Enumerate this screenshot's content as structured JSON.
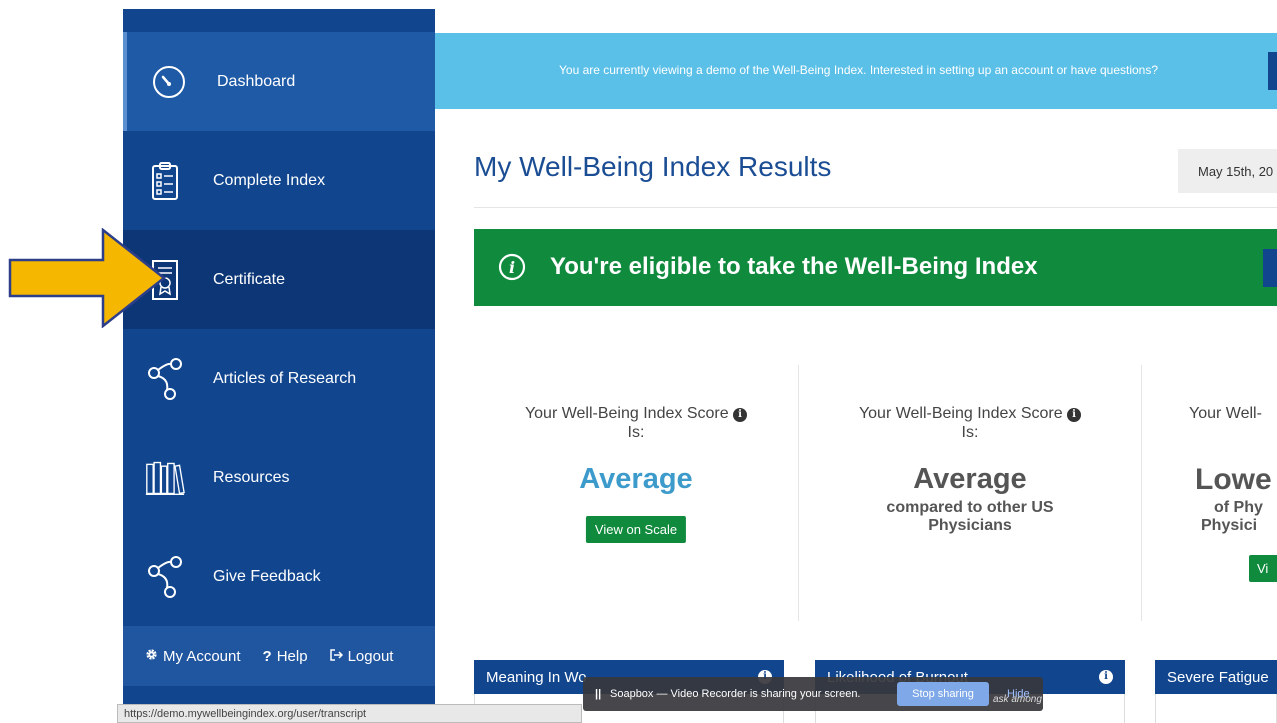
{
  "sidebar": {
    "items": [
      {
        "label": "Dashboard"
      },
      {
        "label": "Complete Index"
      },
      {
        "label": "Certificate"
      },
      {
        "label": "Articles of Research"
      },
      {
        "label": "Resources"
      },
      {
        "label": "Give Feedback"
      }
    ],
    "account": {
      "my_account": "My Account",
      "help": "Help",
      "logout": "Logout"
    }
  },
  "banner": {
    "text": "You are currently viewing a demo of the Well-Being Index. Interested in setting up an account or have questions?"
  },
  "header": {
    "title": "My Well-Being Index Results",
    "date": "May 15th, 20"
  },
  "eligible": {
    "text": "You're eligible to take the Well-Being Index"
  },
  "scores": [
    {
      "label_line1": "Your Well-Being Index Score",
      "label_line2": "Is:",
      "value": "Average",
      "button": "View on Scale"
    },
    {
      "label_line1": "Your Well-Being Index Score",
      "label_line2": "Is:",
      "value": "Average",
      "sub_line1": "compared to other US",
      "sub_line2": "Physicians"
    },
    {
      "label_line1": "Your Well-",
      "value": "Lowe",
      "sub_line1": "of Phy",
      "sub_line2": "Physici",
      "button": "Vi"
    }
  ],
  "cards": [
    {
      "title": "Meaning In Wo"
    },
    {
      "title": "Likelihood of Burnout"
    },
    {
      "title": "Severe Fatigue"
    }
  ],
  "status_url": "https://demo.mywellbeingindex.org/user/transcript",
  "share_bar": {
    "message": "Soapbox — Video Recorder is sharing your screen.",
    "stop": "Stop sharing",
    "hide": "Hide",
    "under_text": "ask among"
  },
  "colors": {
    "sidebar": "#11468f",
    "banner": "#5bc0e8",
    "green": "#108a3d",
    "title": "#1b4d94",
    "arrow": "#f5b700"
  }
}
